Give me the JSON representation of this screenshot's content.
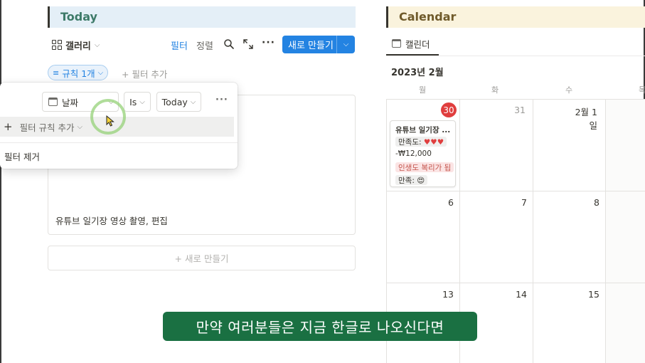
{
  "today": {
    "title": "Today",
    "accent_color": "#e4eff7",
    "toolbar": {
      "view_label": "갤러리",
      "filter_label": "필터",
      "sort_label": "정렬",
      "more_label": "···",
      "new_label": "새로 만들기",
      "new_color": "#2383e2"
    },
    "rule_chip": "규칙 1개",
    "add_filter": "+ 필터 추가",
    "card_title": "유튜브 일기장 영상 촬영, 편집",
    "new_card": "+ 새로 만들기"
  },
  "filter_popup": {
    "property": "날짜",
    "operator": "Is",
    "value": "Today",
    "more_label": "···",
    "add_rule": "필터 규칙 추가",
    "remove": "필터 제거"
  },
  "calendar": {
    "title": "Calendar",
    "accent_color": "#faf3dd",
    "tab_label": "캘린더",
    "month_label": "2023년 2월",
    "weekdays": [
      "월",
      "화",
      "수",
      "목"
    ],
    "rows": [
      [
        "30",
        "31",
        "2월 1일",
        ""
      ],
      [
        "6",
        "7",
        "8",
        ""
      ],
      [
        "13",
        "14",
        "15",
        ""
      ]
    ],
    "today_color": "#e03e3e",
    "event": {
      "title": "유튜브 일기장 ...",
      "satisfaction": "만족도: ♥♥♥",
      "price": "-₩12,000",
      "tag": "인생도 복리가 됩",
      "mood": "만족: 😍"
    }
  },
  "subtitle": "만약 여러분들은 지금 한글로 나오신다면"
}
